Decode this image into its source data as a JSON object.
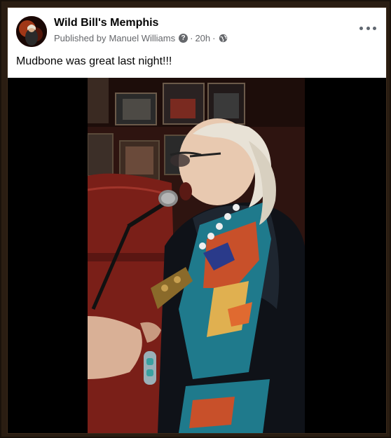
{
  "post": {
    "page_name": "Wild Bill's Memphis",
    "published_by_prefix": "Published by",
    "author": "Manuel Williams",
    "time": "20h",
    "separator": "·",
    "help_glyph": "?",
    "audience_icon": "globe-icon",
    "text": "Mudbone was great last night!!!"
  },
  "colors": {
    "card_bg": "#ffffff",
    "name_text": "#050505",
    "meta_text": "#65676b",
    "frame": "#2a1d12",
    "video_bg": "#000000"
  },
  "media": {
    "type": "video",
    "description_icon": "video-frame"
  }
}
